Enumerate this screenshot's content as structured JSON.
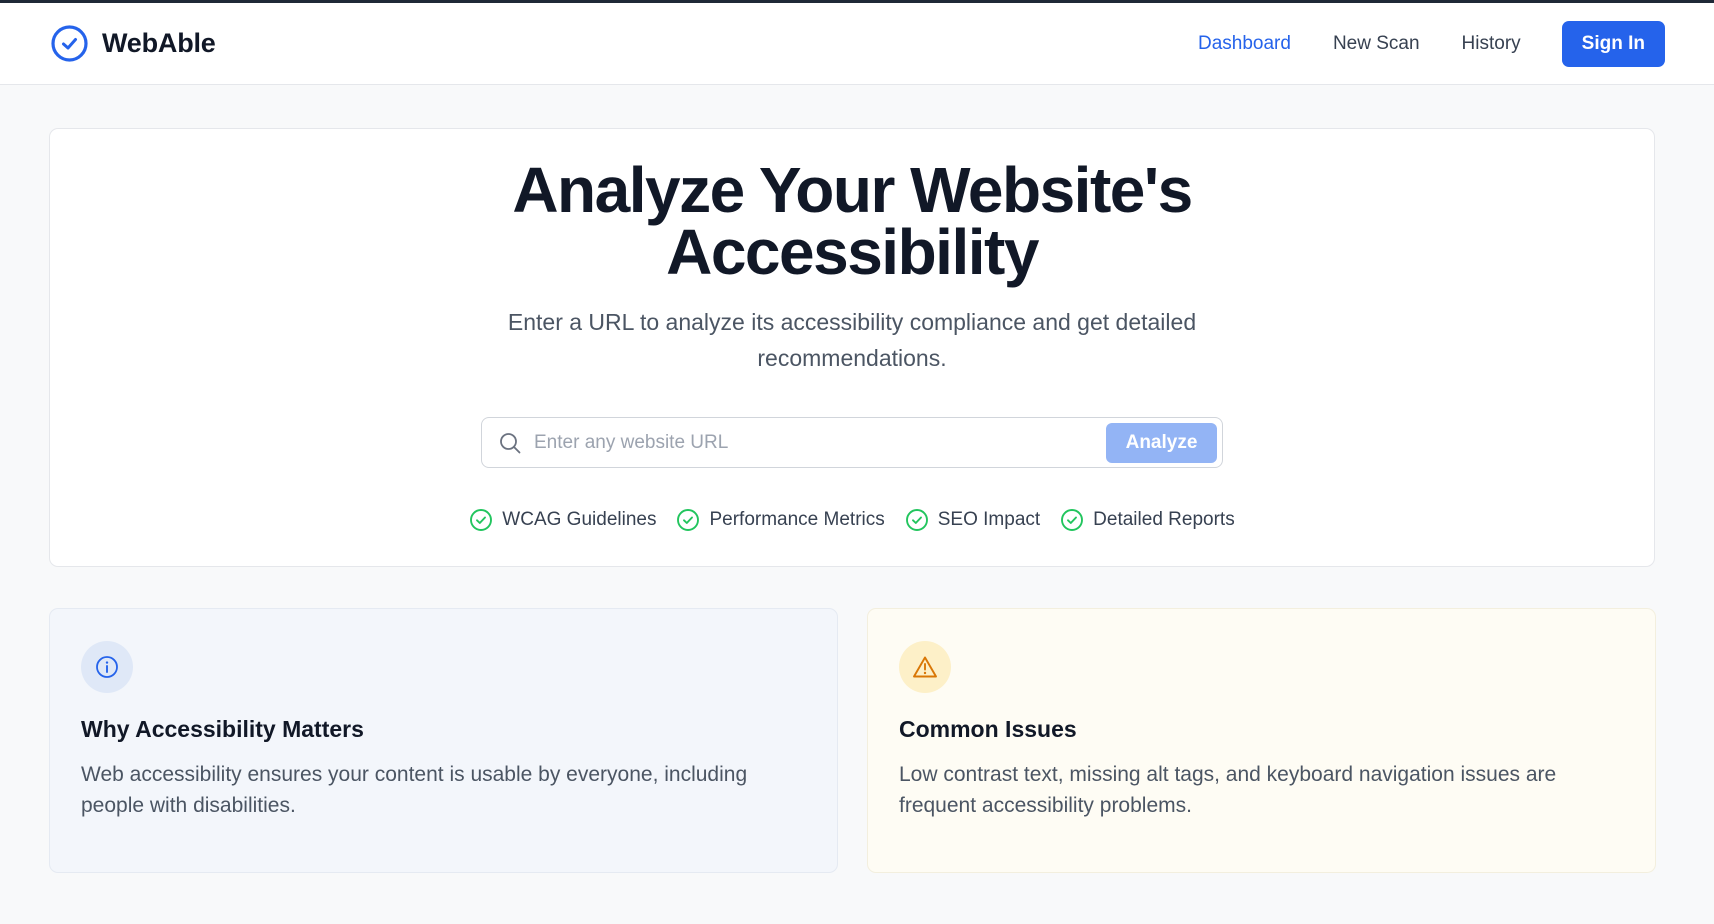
{
  "brand": {
    "name": "WebAble",
    "icon": "check-circle-icon",
    "color": "#2563eb"
  },
  "nav": {
    "items": [
      {
        "label": "Dashboard",
        "active": true
      },
      {
        "label": "New Scan",
        "active": false
      },
      {
        "label": "History",
        "active": false
      }
    ],
    "sign_in_label": "Sign In"
  },
  "hero": {
    "title_lines": [
      "Analyze Your Website's",
      "Accessibility"
    ],
    "subtitle_lines": [
      "Enter a URL to analyze its accessibility compliance and get detailed",
      "recommendations."
    ],
    "search": {
      "placeholder": "Enter any website URL",
      "value": "",
      "button_label": "Analyze"
    },
    "features": [
      {
        "label": "WCAG Guidelines",
        "icon": "check-circle-icon"
      },
      {
        "label": "Performance Metrics",
        "icon": "check-circle-icon"
      },
      {
        "label": "SEO Impact",
        "icon": "check-circle-icon"
      },
      {
        "label": "Detailed Reports",
        "icon": "check-circle-icon"
      }
    ]
  },
  "cards": [
    {
      "icon": "info-icon",
      "title": "Why Accessibility Matters",
      "text_lines": [
        "Web accessibility ensures your content is usable by everyone, including",
        "people with disabilities."
      ]
    },
    {
      "icon": "warning-icon",
      "title": "Common Issues",
      "text_lines": [
        "Low contrast text, missing alt tags, and keyboard navigation issues are",
        "frequent accessibility problems."
      ]
    }
  ],
  "colors": {
    "accent": "#2563eb",
    "success": "#22c55e",
    "warning": "#d97706"
  }
}
